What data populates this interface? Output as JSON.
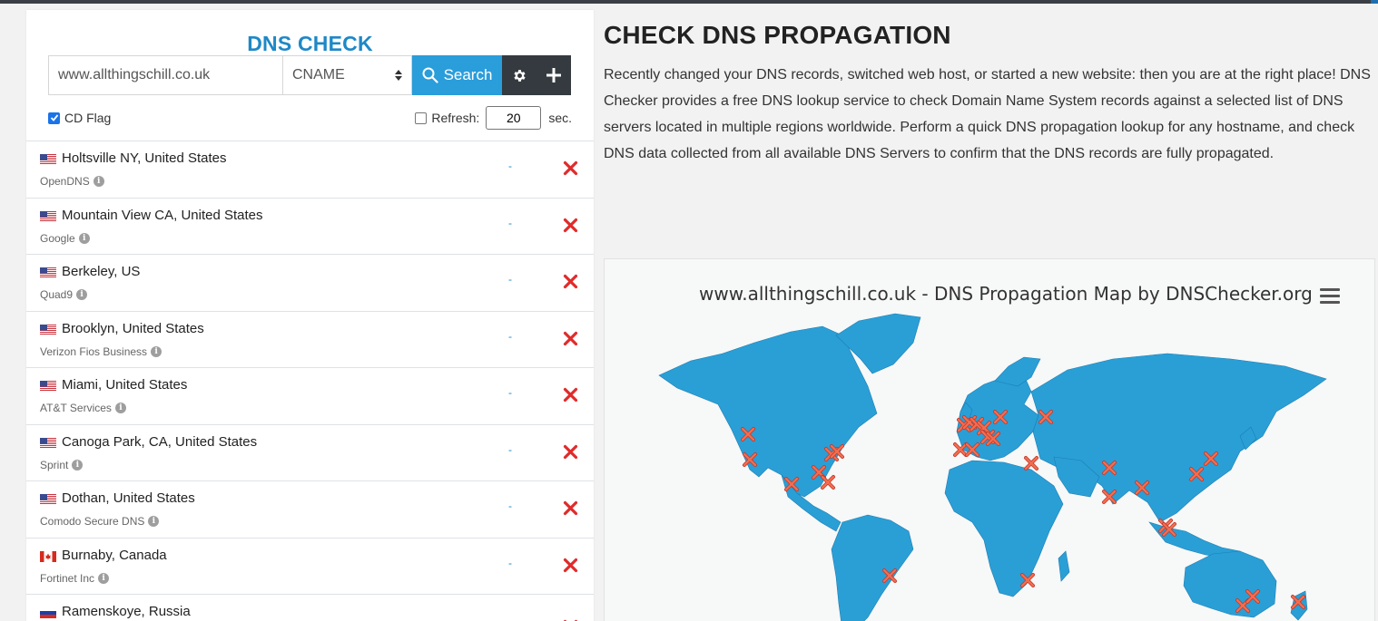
{
  "panel": {
    "title": "DNS CHECK",
    "domain_value": "www.allthingschill.co.uk",
    "record_type": "CNAME",
    "search_label": "Search",
    "cd_flag_label": "CD Flag",
    "cd_flag_checked": true,
    "refresh_label": "Refresh:",
    "refresh_value": "20",
    "refresh_unit": "sec."
  },
  "results": [
    {
      "flag": "us",
      "location": "Holtsville NY, United States",
      "provider": "OpenDNS",
      "result": "-"
    },
    {
      "flag": "us",
      "location": "Mountain View CA, United States",
      "provider": "Google",
      "result": "-"
    },
    {
      "flag": "us",
      "location": "Berkeley, US",
      "provider": "Quad9",
      "result": "-"
    },
    {
      "flag": "us",
      "location": "Brooklyn, United States",
      "provider": "Verizon Fios Business",
      "result": "-"
    },
    {
      "flag": "us",
      "location": "Miami, United States",
      "provider": "AT&T Services",
      "result": "-"
    },
    {
      "flag": "us",
      "location": "Canoga Park, CA, United States",
      "provider": "Sprint",
      "result": "-"
    },
    {
      "flag": "us",
      "location": "Dothan, United States",
      "provider": "Comodo Secure DNS",
      "result": "-"
    },
    {
      "flag": "ca",
      "location": "Burnaby, Canada",
      "provider": "Fortinet Inc",
      "result": "-"
    },
    {
      "flag": "ru",
      "location": "Ramenskoye, Russia",
      "provider": "",
      "result": ""
    }
  ],
  "info": {
    "title": "CHECK DNS PROPAGATION",
    "description": "Recently changed your DNS records, switched web host, or started a new website: then you are at the right place! DNS Checker provides a free DNS lookup service to check Domain Name System records against a selected list of DNS servers located in multiple regions worldwide. Perform a quick DNS propagation lookup for any hostname, and check DNS data collected from all available DNS Servers to confirm that the DNS records are fully propagated."
  },
  "map": {
    "title": "www.allthingschill.co.uk - DNS Propagation Map by DNSChecker.org",
    "land_color": "#2a9fd6",
    "marker_color": "#f26d50"
  },
  "colors": {
    "accent": "#1e88c7",
    "search_button": "#2a9ddb",
    "dark_button": "#343a40",
    "fail_icon": "#e02b2b"
  },
  "icons": {
    "search": "search-icon",
    "settings": "gear-icon",
    "add": "plus-icon",
    "fail": "x-icon",
    "info": "info-icon",
    "menu": "hamburger-menu-icon"
  }
}
